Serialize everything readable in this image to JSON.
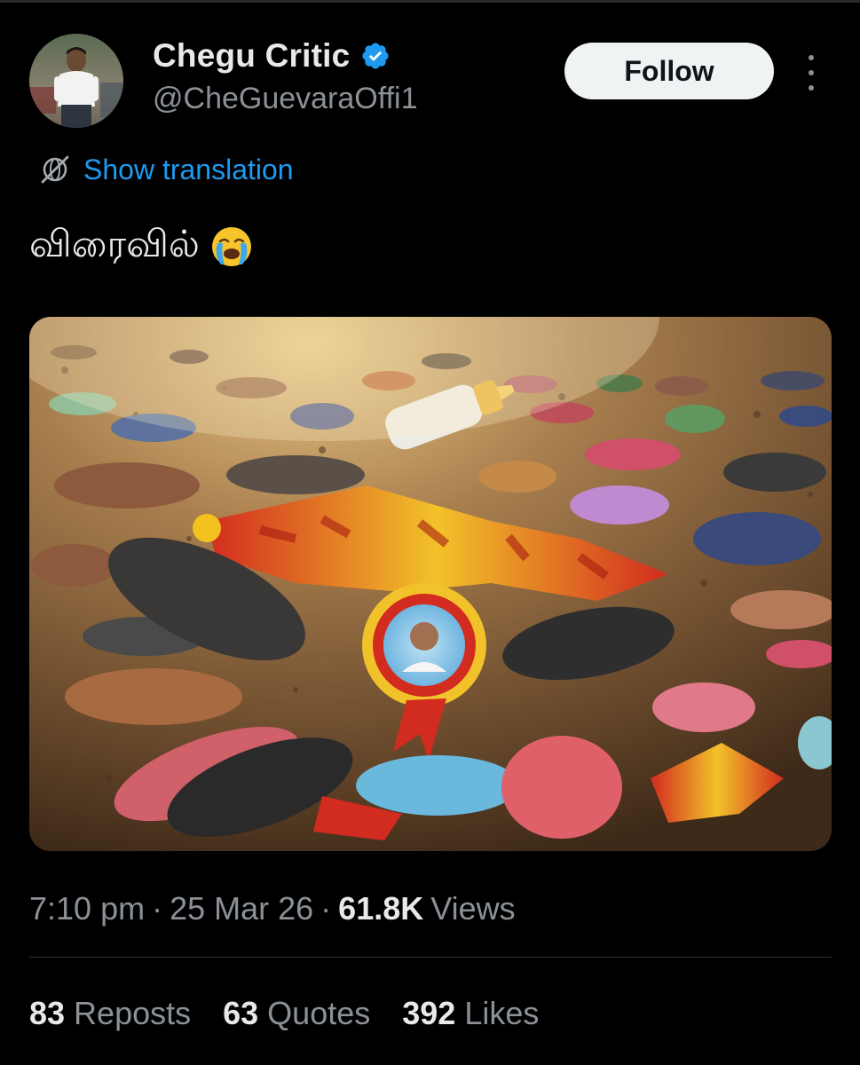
{
  "author": {
    "display_name": "Chegu Critic",
    "handle": "@CheGuevaraOffi1",
    "verified": true
  },
  "follow_label": "Follow",
  "translation": {
    "label": "Show translation",
    "icon": "globe-slash-icon"
  },
  "tweet": {
    "text": "விரைவில்",
    "emoji": "crying-face-emoji"
  },
  "meta": {
    "time": "7:10 pm",
    "separator": "·",
    "date": "25 Mar 26",
    "views_count": "61.8K",
    "views_label": "Views"
  },
  "stats": [
    {
      "count": "83",
      "label": "Reposts"
    },
    {
      "count": "63",
      "label": "Quotes"
    },
    {
      "count": "392",
      "label": "Likes"
    }
  ],
  "colors": {
    "background": "#000000",
    "link": "#1d9bf0",
    "verified": "#1d9bf0",
    "secondary_text": "#8b9197",
    "primary_text": "#e7e9ea",
    "follow_button_bg": "#eff3f4"
  }
}
